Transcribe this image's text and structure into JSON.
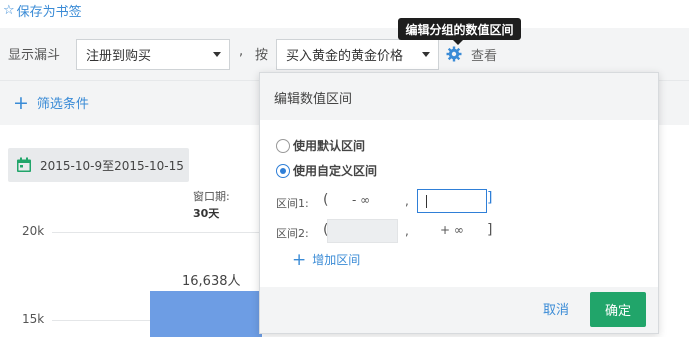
{
  "bookmark": {
    "label": "保存为书签"
  },
  "filter": {
    "funnel_label": "显示漏斗",
    "funnel_value": "注册到购买",
    "comma": ",",
    "by_label": "按",
    "group_value": "买入黄金的黄金价格",
    "view_label": "查看"
  },
  "tooltip": {
    "text": "编辑分组的数值区间"
  },
  "add_filter": {
    "label": "筛选条件"
  },
  "date_range": {
    "text": "2015-10-9至2015-10-15"
  },
  "window": {
    "label": "窗口期:",
    "value": "30天"
  },
  "chart_data": {
    "type": "bar",
    "categories": [
      ""
    ],
    "values": [
      16638
    ],
    "data_labels": [
      "16,638人"
    ],
    "yticks": [
      "20k",
      "15k"
    ],
    "ylim": [
      0,
      21500
    ]
  },
  "dialog": {
    "title": "编辑数值区间",
    "radio_default": "使用默认区间",
    "radio_custom": "使用自定义区间",
    "selected": "custom",
    "range1_label": "区间1:",
    "range1_start": "- ∞",
    "range1_end": "",
    "range2_label": "区间2:",
    "range2_start": "",
    "range2_end": "+ ∞",
    "open_paren": "(",
    "close_paren": "]",
    "comma": ",",
    "add_range": "增加区间",
    "cancel": "取消",
    "ok": "确定"
  },
  "colors": {
    "accent": "#3a8bd6",
    "bar": "#6d9de4",
    "ok_button": "#21a56a",
    "tooltip_bg": "#1e1e1e"
  },
  "icons": [
    "star-icon",
    "chevron-down-icon",
    "gear-icon",
    "plus-icon",
    "calendar-icon"
  ]
}
